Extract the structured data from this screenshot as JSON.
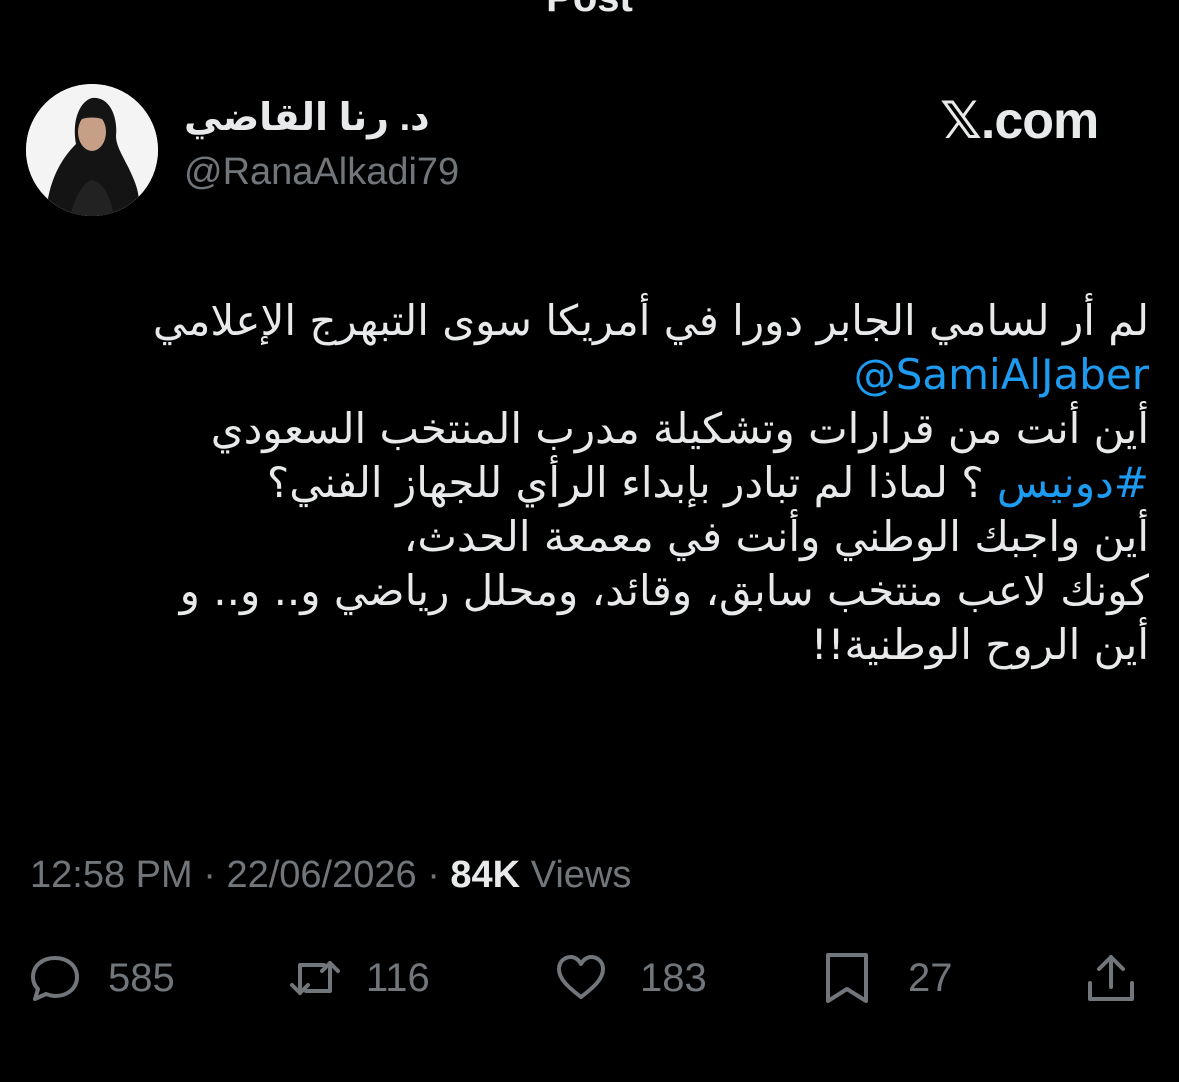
{
  "header": {
    "title": "Post"
  },
  "author": {
    "name": "د. رنا القاضي",
    "handle": "@RanaAlkadi79"
  },
  "source": {
    "label": "𝕏.com"
  },
  "tweet": {
    "line1": "لم أر لسامي الجابر دورا في أمريكا سوى التبهرج الإعلامي",
    "mention": "@SamiAlJaber",
    "line3": "أين أنت من قرارات وتشكيلة مدرب المنتخب السعودي",
    "hashtag": "#دونيس",
    "line4_rest": " ؟ لماذا لم تبادر بإبداء الرأي للجهاز الفني؟",
    "line5": "أين واجبك الوطني وأنت في معمعة الحدث،",
    "line6": "كونك لاعب منتخب سابق، وقائد، ومحلل رياضي و.. و.. و",
    "line7": "أين الروح الوطنية!!"
  },
  "meta": {
    "time": "12:58 PM",
    "separator": "·",
    "date": "22/06/2026",
    "views_count": "84K",
    "views_label": "Views"
  },
  "actions": {
    "replies": "585",
    "reposts": "116",
    "likes": "183",
    "bookmarks": "27"
  },
  "colors": {
    "background": "#000000",
    "text": "#e7e9ea",
    "muted": "#71767b",
    "link": "#1d9bf0"
  }
}
